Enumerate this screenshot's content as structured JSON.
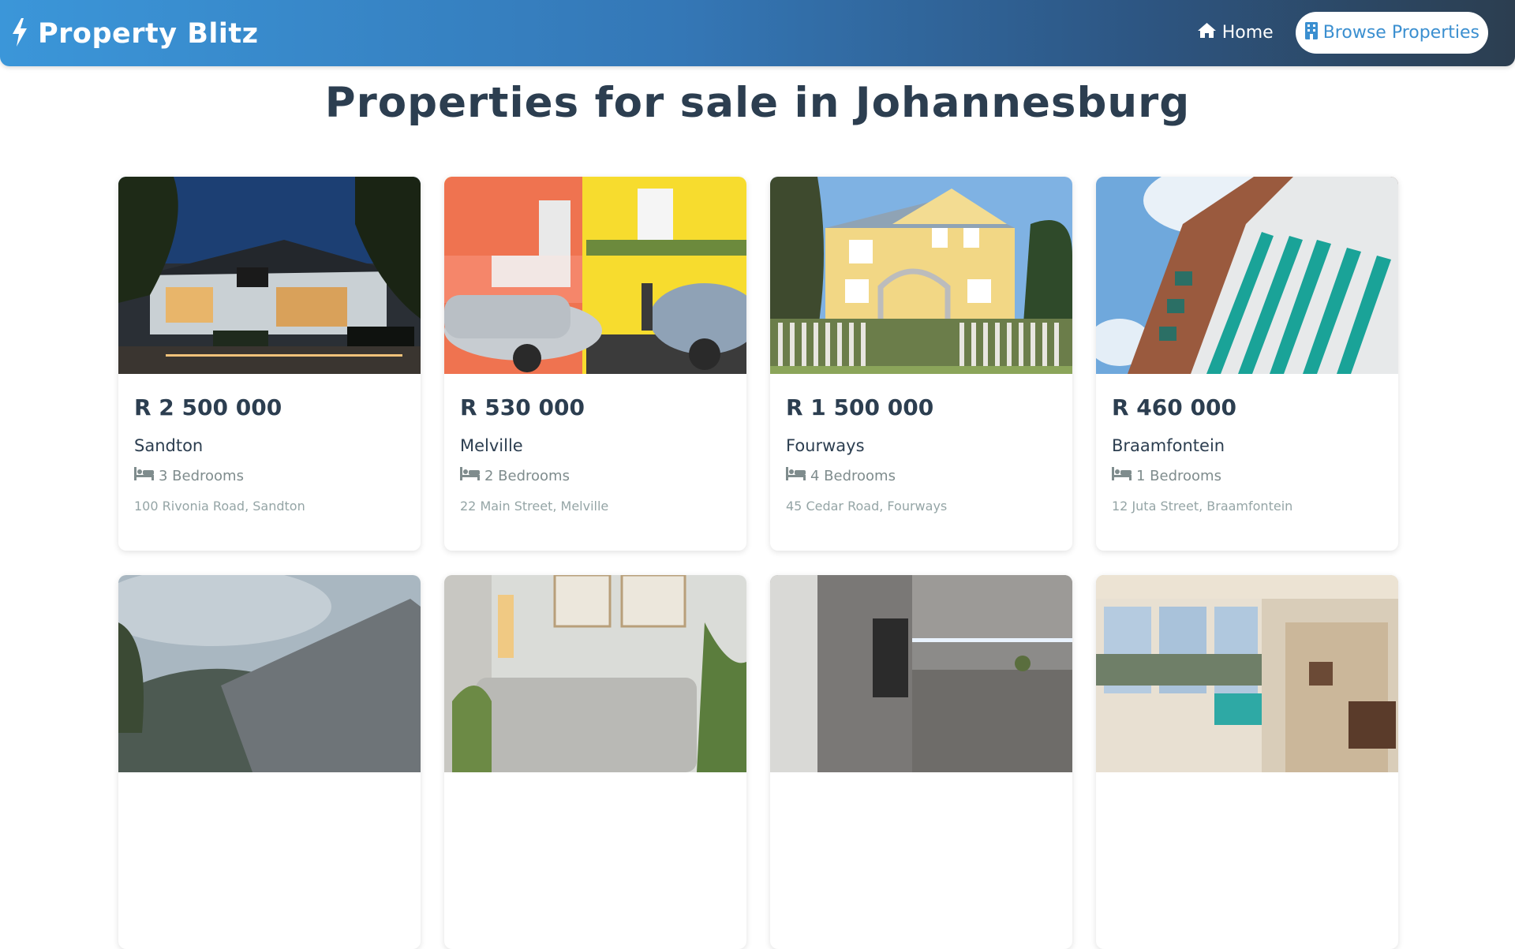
{
  "brand": {
    "name": "Property Blitz",
    "icon": "bolt-icon"
  },
  "nav": {
    "home_label": "Home",
    "home_icon": "home-icon",
    "browse_label": "Browse Properties",
    "browse_icon": "building-icon"
  },
  "page": {
    "title": "Properties for sale in Johannesburg"
  },
  "listings": [
    {
      "price": "R 2 500 000",
      "suburb": "Sandton",
      "bedrooms": "3 Bedrooms",
      "address": "100 Rivonia Road, Sandton",
      "image": "restaurant-exterior-photo"
    },
    {
      "price": "R 530 000",
      "suburb": "Melville",
      "bedrooms": "2 Bedrooms",
      "address": "22 Main Street, Melville",
      "image": "colorful-houses-street-photo"
    },
    {
      "price": "R 1 500 000",
      "suburb": "Fourways",
      "bedrooms": "4 Bedrooms",
      "address": "45 Cedar Road, Fourways",
      "image": "yellow-house-garden-photo"
    },
    {
      "price": "R 460 000",
      "suburb": "Braamfontein",
      "bedrooms": "1 Bedrooms",
      "address": "12 Juta Street, Braamfontein",
      "image": "apartment-building-photo"
    },
    {
      "image": "roof-mountain-photo"
    },
    {
      "image": "living-room-photo"
    },
    {
      "image": "modern-kitchen-photo"
    },
    {
      "image": "open-plan-lounge-photo"
    }
  ],
  "colors": {
    "navbar_start": "#3b96d9",
    "navbar_end": "#2c3e50",
    "active_link_text": "#3b8fd0",
    "heading": "#2c3e50",
    "muted": "#7f8c8d"
  }
}
